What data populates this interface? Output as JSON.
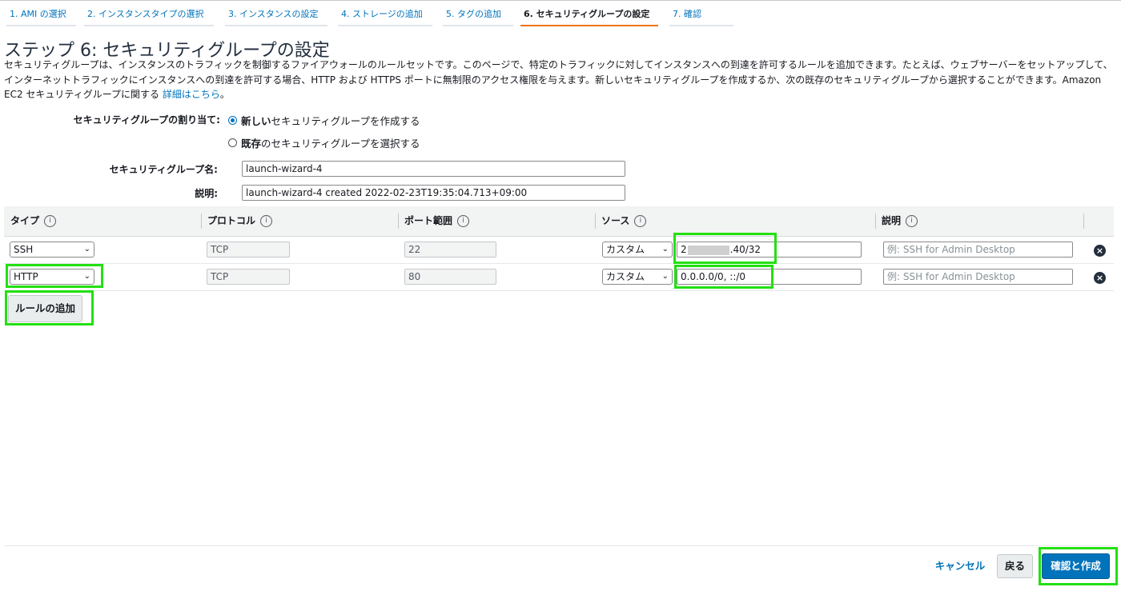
{
  "wizard": {
    "tabs": [
      {
        "label": "1. AMI の選択"
      },
      {
        "label": "2. インスタンスタイプの選択"
      },
      {
        "label": "3. インスタンスの設定"
      },
      {
        "label": "4. ストレージの追加"
      },
      {
        "label": "5. タグの追加"
      },
      {
        "label": "6. セキュリティグループの設定"
      },
      {
        "label": "7. 確認"
      }
    ],
    "active_tab": "6. セキュリティグループの設定"
  },
  "page": {
    "title": "ステップ 6: セキュリティグループの設定",
    "description": "セキュリティグループは、インスタンスのトラフィックを制御するファイアウォールのルールセットです。このページで、特定のトラフィックに対してインスタンスへの到達を許可するルールを追加できます。たとえば、ウェブサーバーをセットアップして、インターネットトラフィックにインスタンスへの到達を許可する場合、HTTP および HTTPS ポートに無制限のアクセス権限を与えます。新しいセキュリティグループを作成するか、次の既存のセキュリティグループから選択することができます。Amazon EC2 セキュリティグループに関する",
    "details_link": "詳細はこちら",
    "description_end": "。"
  },
  "form": {
    "assign_label": "セキュリティグループの割り当て:",
    "option_new_bold": "新しい",
    "option_new_rest": "セキュリティグループを作成する",
    "option_existing_bold": "既存",
    "option_existing_rest": "のセキュリティグループを選択する",
    "selected_option": "new",
    "name_label": "セキュリティグループ名:",
    "name_value": "launch-wizard-4",
    "desc_label": "説明:",
    "desc_value": "launch-wizard-4 created 2022-02-23T19:35:04.713+09:00"
  },
  "table": {
    "headers": {
      "type": "タイプ",
      "protocol": "プロトコル",
      "port_range": "ポート範囲",
      "source": "ソース",
      "description": "説明"
    },
    "info_glyph": "i",
    "rows": [
      {
        "type": "SSH",
        "protocol": "TCP",
        "port": "22",
        "source_mode": "カスタム",
        "source_prefix": "2",
        "source_suffix": ".40/32",
        "desc_placeholder": "例: SSH for Admin Desktop"
      },
      {
        "type": "HTTP",
        "protocol": "TCP",
        "port": "80",
        "source_mode": "カスタム",
        "source_value": "0.0.0.0/0, ::/0",
        "desc_placeholder": "例: SSH for Admin Desktop"
      }
    ],
    "add_rule_label": "ルールの追加"
  },
  "footer": {
    "cancel_label": "キャンセル",
    "back_label": "戻る",
    "review_label": "確認と作成"
  },
  "icons": {
    "chevron": "chevron-down-icon",
    "delete": "remove-circle-icon",
    "info": "info-icon"
  },
  "colors": {
    "link": "#0073bb",
    "active_tab_underline": "#ec7211",
    "primary_button": "#0073bb",
    "highlight": "#22e011"
  }
}
